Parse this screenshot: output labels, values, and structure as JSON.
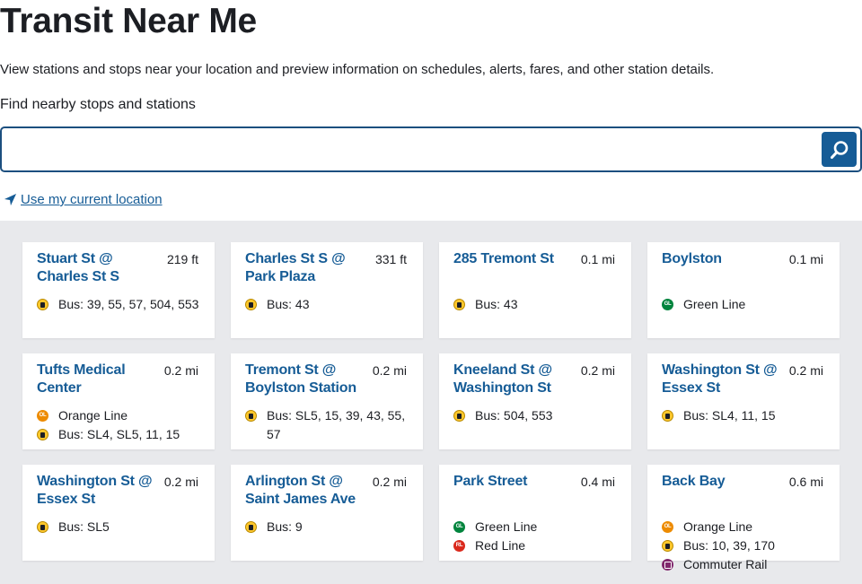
{
  "page": {
    "title": "Transit Near Me",
    "intro": "View stations and stops near your location and preview information on schedules, alerts, fares, and other station details.",
    "search_label": "Find nearby stops and stations",
    "search_placeholder": "",
    "location_link": "Use my current location"
  },
  "colors": {
    "brand_blue": "#165c96",
    "panel_gray": "#e8e9ec",
    "orange_line": "#ed8b00",
    "green_line": "#00843d",
    "red_line": "#da291c",
    "bus": "#ffc72c",
    "commuter_rail": "#80276c"
  },
  "stops": [
    {
      "name": "Stuart St @ Charles St S",
      "distance": "219 ft",
      "routes": [
        {
          "icon": "bus-icon",
          "badge": "",
          "text": "Bus: 39, 55, 57, 504, 553"
        }
      ]
    },
    {
      "name": "Charles St S @ Park Plaza",
      "distance": "331 ft",
      "routes": [
        {
          "icon": "bus-icon",
          "badge": "",
          "text": "Bus: 43"
        }
      ]
    },
    {
      "name": "285 Tremont St",
      "distance": "0.1 mi",
      "routes": [
        {
          "icon": "bus-icon",
          "badge": "",
          "text": "Bus: 43"
        }
      ]
    },
    {
      "name": "Boylston",
      "distance": "0.1 mi",
      "routes": [
        {
          "icon": "green-line-icon",
          "badge": "GL",
          "text": "Green Line"
        }
      ]
    },
    {
      "name": "Tufts Medical Center",
      "distance": "0.2 mi",
      "routes": [
        {
          "icon": "orange-line-icon",
          "badge": "OL",
          "text": "Orange Line"
        },
        {
          "icon": "bus-icon",
          "badge": "",
          "text": "Bus: SL4, SL5, 11, 15"
        }
      ]
    },
    {
      "name": "Tremont St @ Boylston Station",
      "distance": "0.2 mi",
      "routes": [
        {
          "icon": "bus-icon",
          "badge": "",
          "text": "Bus: SL5, 15, 39, 43, 55, 57"
        }
      ]
    },
    {
      "name": "Kneeland St @ Washington St",
      "distance": "0.2 mi",
      "routes": [
        {
          "icon": "bus-icon",
          "badge": "",
          "text": "Bus: 504, 553"
        }
      ]
    },
    {
      "name": "Washington St @ Essex St",
      "distance": "0.2 mi",
      "routes": [
        {
          "icon": "bus-icon",
          "badge": "",
          "text": "Bus: SL4, 11, 15"
        }
      ]
    },
    {
      "name": "Washington St @ Essex St",
      "distance": "0.2 mi",
      "routes": [
        {
          "icon": "bus-icon",
          "badge": "",
          "text": "Bus: SL5"
        }
      ]
    },
    {
      "name": "Arlington St @ Saint James Ave",
      "distance": "0.2 mi",
      "routes": [
        {
          "icon": "bus-icon",
          "badge": "",
          "text": "Bus: 9"
        }
      ]
    },
    {
      "name": "Park Street",
      "distance": "0.4 mi",
      "routes": [
        {
          "icon": "green-line-icon",
          "badge": "GL",
          "text": "Green Line"
        },
        {
          "icon": "red-line-icon",
          "badge": "RL",
          "text": "Red Line"
        }
      ]
    },
    {
      "name": "Back Bay",
      "distance": "0.6 mi",
      "routes": [
        {
          "icon": "orange-line-icon",
          "badge": "OL",
          "text": "Orange Line"
        },
        {
          "icon": "bus-icon",
          "badge": "",
          "text": "Bus: 10, 39, 170"
        },
        {
          "icon": "commuter-rail-icon",
          "badge": "",
          "text": "Commuter Rail"
        }
      ]
    }
  ]
}
